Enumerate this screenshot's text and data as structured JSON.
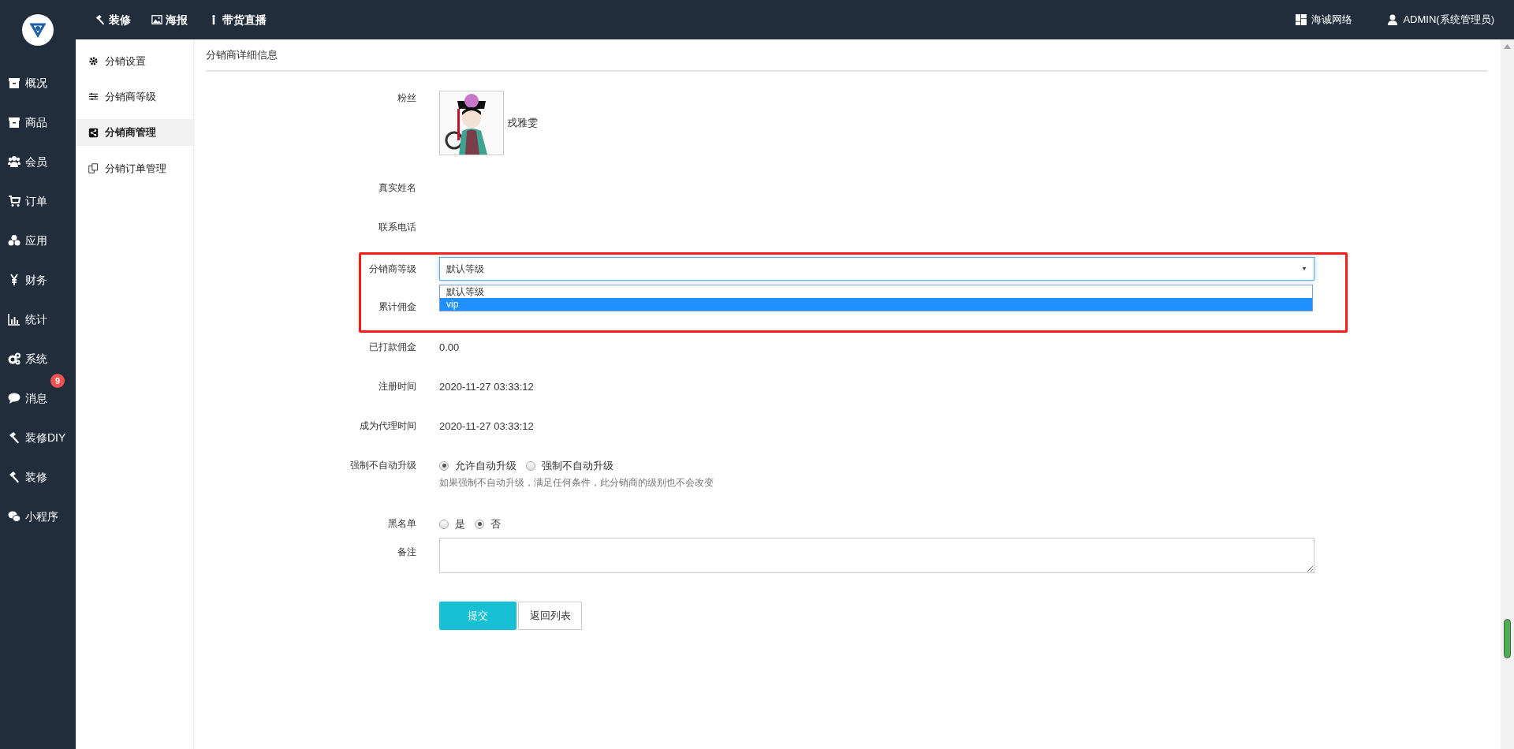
{
  "top_nav": [
    {
      "label": "装修"
    },
    {
      "label": "海报"
    },
    {
      "label": "带货直播"
    }
  ],
  "header_right": [
    {
      "label": "海诚网络"
    },
    {
      "label": "ADMIN(系统管理员)"
    }
  ],
  "side_nav": [
    {
      "label": "概况"
    },
    {
      "label": "商品"
    },
    {
      "label": "会员"
    },
    {
      "label": "订单"
    },
    {
      "label": "应用"
    },
    {
      "label": "财务"
    },
    {
      "label": "统计"
    },
    {
      "label": "系统"
    },
    {
      "label": "消息",
      "badge": "9"
    },
    {
      "label": "装修DIY"
    },
    {
      "label": "装修"
    },
    {
      "label": "小程序"
    }
  ],
  "sub_nav": [
    {
      "label": "分销设置",
      "selected": false
    },
    {
      "label": "分销商等级",
      "selected": false
    },
    {
      "label": "分销商管理",
      "selected": true
    },
    {
      "label": "分销订单管理",
      "selected": false
    }
  ],
  "page_title": "分销商详细信息",
  "form": [
    {
      "kind": "avatar",
      "label": "粉丝",
      "value": "戎雅雯"
    },
    {
      "kind": "text",
      "label": "真实姓名"
    },
    {
      "kind": "text",
      "label": "联系电话"
    },
    {
      "kind": "select",
      "label": "分销商等级",
      "value": "默认等级",
      "expanded": true,
      "highlighted": true,
      "options": [
        {
          "label": "默认等级",
          "hovered": false
        },
        {
          "label": "vip",
          "hovered": true
        }
      ]
    },
    {
      "kind": "text",
      "label": "累计佣金",
      "highlighted": true
    },
    {
      "kind": "text",
      "label": "已打款佣金",
      "value": "0.00"
    },
    {
      "kind": "text",
      "label": "注册时间",
      "value": "2020-11-27 03:33:12"
    },
    {
      "kind": "text",
      "label": "成为代理时间",
      "value": "2020-11-27 03:33:12"
    },
    {
      "kind": "radio",
      "label": "强制不自动升级",
      "options": [
        {
          "label": "允许自动升级",
          "checked": true
        },
        {
          "label": "强制不自动升级",
          "checked": false
        }
      ],
      "hint": "如果强制不自动升级，满足任何条件，此分销商的级别也不会改变"
    },
    {
      "kind": "radio",
      "label": "黑名单",
      "options": [
        {
          "label": "是",
          "checked": false
        },
        {
          "label": "否",
          "checked": true
        }
      ]
    },
    {
      "kind": "textarea",
      "label": "备注"
    }
  ],
  "buttons": [
    {
      "label": "提交",
      "kind": "primary"
    },
    {
      "label": "返回列表",
      "kind": "default"
    }
  ]
}
